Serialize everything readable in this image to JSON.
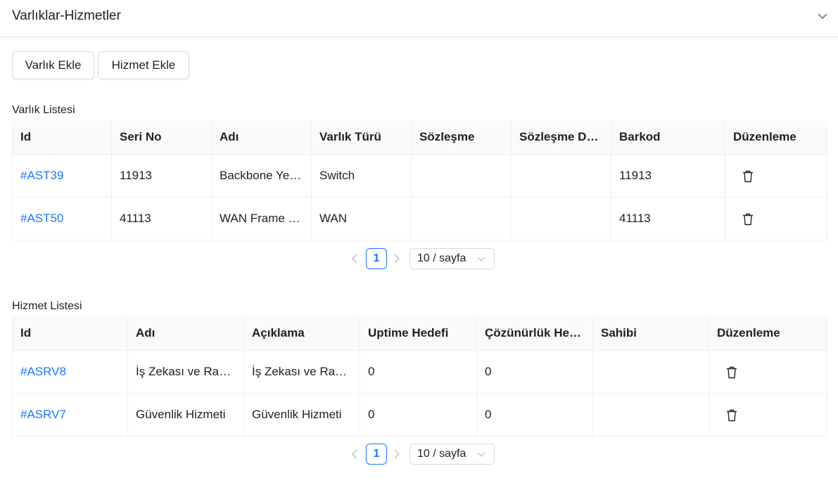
{
  "panel": {
    "title": "Varlıklar-Hizmetler"
  },
  "toolbar": {
    "add_asset_label": "Varlık Ekle",
    "add_service_label": "Hizmet Ekle"
  },
  "assets": {
    "section_label": "Varlık Listesi",
    "columns": [
      "Id",
      "Seri No",
      "Adı",
      "Varlık Türü",
      "Sözleşme",
      "Sözleşme Du…",
      "Barkod",
      "Düzenleme"
    ],
    "rows": [
      {
        "id": "#AST39",
        "serial": "11913",
        "name": "Backbone Yed…",
        "type": "Switch",
        "contract": "",
        "contract_duration": "",
        "barcode": "11913"
      },
      {
        "id": "#AST50",
        "serial": "41113",
        "name": "WAN Frame R…",
        "type": "WAN",
        "contract": "",
        "contract_duration": "",
        "barcode": "41113"
      }
    ],
    "pagination": {
      "current_page": "1",
      "page_size": "10 / sayfa"
    }
  },
  "services": {
    "section_label": "Hizmet Listesi",
    "columns": [
      "Id",
      "Adı",
      "Açıklama",
      "Uptime Hedefi",
      "Çözünürlük Hed…",
      "Sahibi",
      "Düzenleme"
    ],
    "rows": [
      {
        "id": "#ASRV8",
        "name": "İş Zekası ve Rap…",
        "description": "İş Zekası ve Rapo…",
        "uptime": "0",
        "resolution": "0",
        "owner": ""
      },
      {
        "id": "#ASRV7",
        "name": "Güvenlik Hizmeti",
        "description": "Güvenlik Hizmeti",
        "uptime": "0",
        "resolution": "0",
        "owner": ""
      }
    ],
    "pagination": {
      "current_page": "1",
      "page_size": "10 / sayfa"
    }
  },
  "colors": {
    "link": "#1677ff",
    "border": "#f0f0f0",
    "header_bg": "#fafafa"
  },
  "icons": {
    "collapse": "chevron-down-icon",
    "delete": "trash-icon",
    "prev": "chevron-left-icon",
    "next": "chevron-right-icon"
  }
}
